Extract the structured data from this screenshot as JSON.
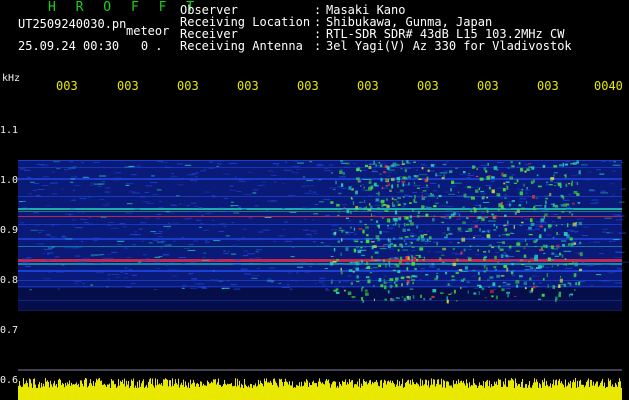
{
  "header": {
    "title": "H R O F F T",
    "filename": "UT2509240030.pn",
    "mode_tag": "meteor",
    "date_time": "25.09.24 00:30",
    "count": "0 .",
    "meta": [
      {
        "key": "Observer",
        "value": "Masaki Kano"
      },
      {
        "key": "Receiving Location",
        "value": "Shibukawa, Gunma, Japan"
      },
      {
        "key": "Receiver",
        "value": "RTL-SDR SDR# 43dB L15 103.2MHz CW"
      },
      {
        "key": "Receiving Antenna",
        "value": "3el Yagi(V) Az 330 for Vladivostok"
      }
    ]
  },
  "chart_data": {
    "type": "heatmap",
    "ylabel": "kHz",
    "y_ticks": [
      "1.1",
      "1.0",
      "0.9",
      "0.8",
      "0.7",
      "0.6"
    ],
    "x_ticks": [
      "003",
      "003",
      "003",
      "003",
      "003",
      "003",
      "003",
      "003",
      "003",
      "0040"
    ],
    "colors": {
      "background": "#000000",
      "noise": "#0a1a78",
      "weak": "#1e46dc",
      "medium": "#24d0c0",
      "strong": "#40e040",
      "peak": "#ff3040",
      "amplitude": "#e8e800"
    }
  }
}
